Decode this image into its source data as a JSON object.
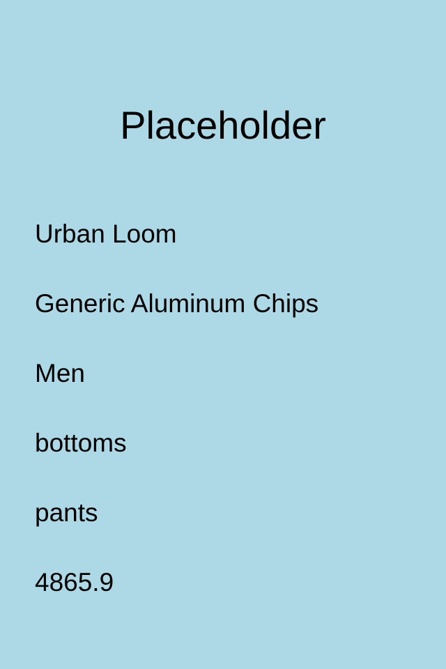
{
  "screen": {
    "background_color": "#add8e6",
    "text_color": "#000000",
    "title": "Placeholder"
  },
  "product": {
    "brand": "Urban Loom",
    "name": "Generic Aluminum Chips",
    "gender": "Men",
    "category": "bottoms",
    "subcategory": "pants",
    "price": "4865.9"
  }
}
